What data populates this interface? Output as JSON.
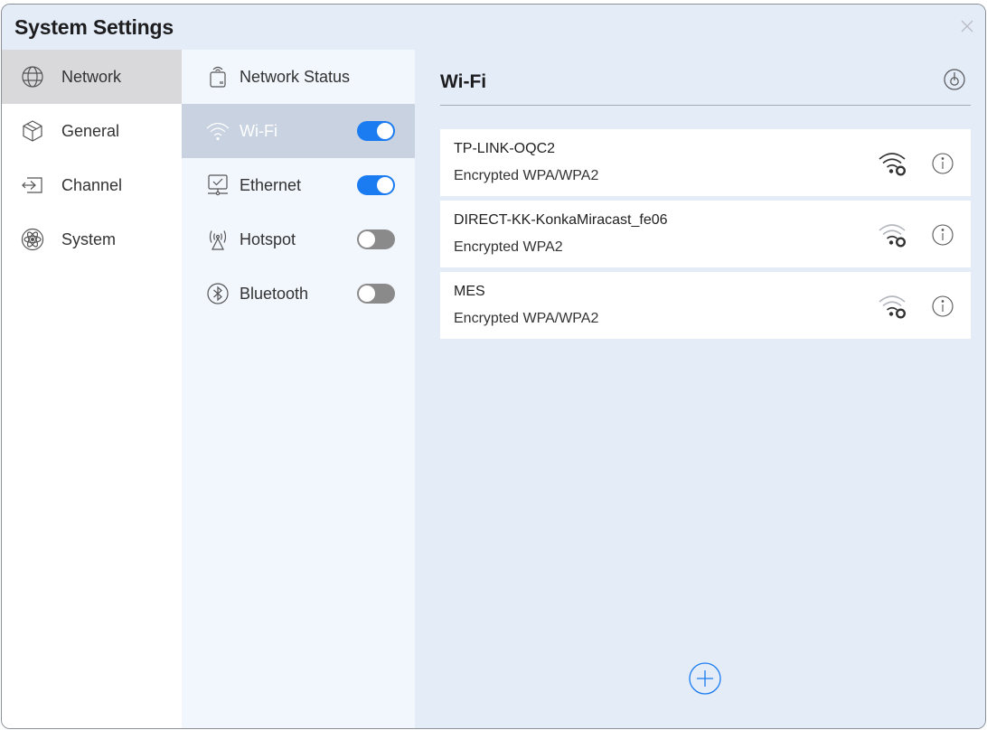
{
  "window": {
    "title": "System Settings"
  },
  "nav_primary": [
    {
      "label": "Network",
      "icon": "globe-icon",
      "active": true
    },
    {
      "label": "General",
      "icon": "cube-icon",
      "active": false
    },
    {
      "label": "Channel",
      "icon": "input-source-icon",
      "active": false
    },
    {
      "label": "System",
      "icon": "atom-icon",
      "active": false
    }
  ],
  "nav_secondary": [
    {
      "label": "Network Status",
      "icon": "router-icon",
      "active": false
    },
    {
      "label": "Wi-Fi",
      "icon": "wifi-icon",
      "active": true,
      "toggle": "on"
    },
    {
      "label": "Ethernet",
      "icon": "ethernet-icon",
      "active": false,
      "toggle": "on"
    },
    {
      "label": "Hotspot",
      "icon": "hotspot-icon",
      "active": false,
      "toggle": "off"
    },
    {
      "label": "Bluetooth",
      "icon": "bluetooth-icon",
      "active": false,
      "toggle": "off"
    }
  ],
  "main": {
    "title": "Wi-Fi",
    "networks": [
      {
        "name": "TP-LINK-OQC2",
        "security": "Encrypted WPA/WPA2",
        "signal": "strong"
      },
      {
        "name": "DIRECT-KK-KonkaMiracast_fe06",
        "security": "Encrypted WPA2",
        "signal": "weak"
      },
      {
        "name": "MES",
        "security": "Encrypted WPA/WPA2",
        "signal": "weak"
      }
    ]
  },
  "colors": {
    "accent": "#1a7cf0",
    "window_bg": "#e4ecf8",
    "secondary_nav_bg": "#f2f6fd",
    "active_primary": "#d9d9db",
    "active_secondary": "#c8d2e0"
  }
}
